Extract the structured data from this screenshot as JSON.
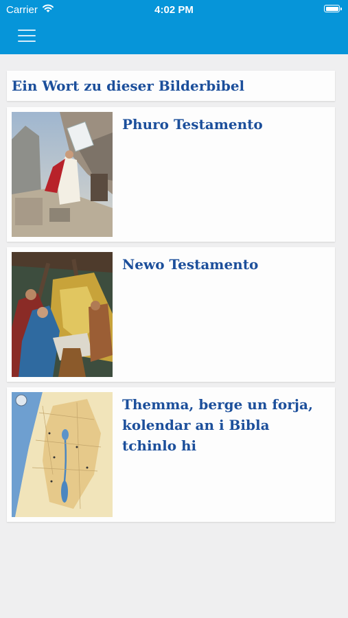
{
  "status_bar": {
    "carrier": "Carrier",
    "time": "4:02 PM"
  },
  "header": {
    "menu_icon": "hamburger-menu-icon"
  },
  "intro_item": {
    "title": "Ein Wort zu dieser Bilderbibel"
  },
  "items": [
    {
      "label": "Phuro Testamento"
    },
    {
      "label": "Newo Testamento"
    },
    {
      "label": "Themma, berge un forja, kolendar an i Bibla tchinlo hi"
    }
  ],
  "colors": {
    "bar": "#0695d9",
    "title_text": "#1c4f9b",
    "background": "#efeff0"
  }
}
